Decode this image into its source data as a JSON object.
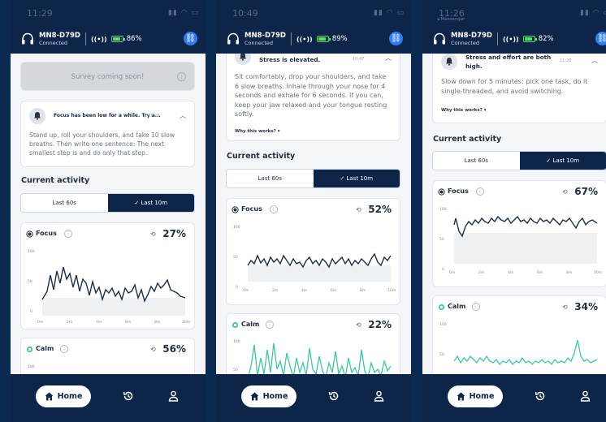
{
  "colors": {
    "navy": "#0c2548",
    "blue": "#2f7df0",
    "green": "#5cdc6c",
    "teal": "#3ec7a4"
  },
  "nav": {
    "home_label": "Home"
  },
  "screens": [
    {
      "status": {
        "time": "11:29",
        "back": ""
      },
      "device": {
        "name": "MN8-D79D",
        "state": "Connected",
        "battery": "86%"
      },
      "survey": {
        "text": "Survey coming soon!"
      },
      "notice": {
        "title": "Focus has been low for a while. Try a...",
        "time": "11:29",
        "body": "Stand up, roll your shoulders, and take 10 slow breaths. Then write one sentence: The next smallest step is and do only that step.",
        "why": ""
      },
      "activity": {
        "title": "Current activity",
        "seg_a": "Last 60s",
        "seg_b": "Last 10m"
      },
      "charts": [
        {
          "label": "Focus",
          "pct": "27%",
          "y": [
            100,
            50,
            0
          ],
          "x": [
            "0m",
            "2m",
            "4m",
            "6m",
            "8m",
            "10m"
          ]
        },
        {
          "label": "Calm",
          "pct": "56%",
          "y": [
            100
          ],
          "x": []
        }
      ]
    },
    {
      "status": {
        "time": "10:49",
        "back": ""
      },
      "device": {
        "name": "MN8-D79D",
        "state": "Connected",
        "battery": "89%"
      },
      "notice": {
        "title": "Stress is elevated.",
        "time": "10:47",
        "body": "Sit comfortably, drop your shoulders, and take 6 slow breaths. Inhale through your nose for 4 seconds and exhale for 6 seconds. If you can, keep your jaw relaxed and your tongue resting softly.",
        "why": "Why this works?"
      },
      "activity": {
        "title": "Current activity",
        "seg_a": "Last 60s",
        "seg_b": "Last 10m"
      },
      "charts": [
        {
          "label": "Focus",
          "pct": "52%",
          "y": [
            100,
            50,
            0
          ],
          "x": [
            "0m",
            "2m",
            "4m",
            "6m",
            "8m",
            "10m"
          ]
        },
        {
          "label": "Calm",
          "pct": "22%",
          "y": [
            100,
            50
          ],
          "x": []
        }
      ]
    },
    {
      "status": {
        "time": "11:26",
        "back": "◂ Messenger"
      },
      "device": {
        "name": "MN8-D79D",
        "state": "Connected",
        "battery": "82%"
      },
      "notice": {
        "title": "Stress and effort are both high.",
        "time": "11:26",
        "body": "Slow down for 5 minutes: pick one task, do it single-threaded, and avoid switching.",
        "why": "Why this works?"
      },
      "activity": {
        "title": "Current activity",
        "seg_a": "Last 60s",
        "seg_b": "Last 10m"
      },
      "charts": [
        {
          "label": "Focus",
          "pct": "67%",
          "y": [
            100,
            50,
            0
          ],
          "x": [
            "0m",
            "2m",
            "4m",
            "6m",
            "8m",
            "10m"
          ]
        },
        {
          "label": "Calm",
          "pct": "34%",
          "y": [
            100,
            50
          ],
          "x": []
        }
      ]
    }
  ]
}
